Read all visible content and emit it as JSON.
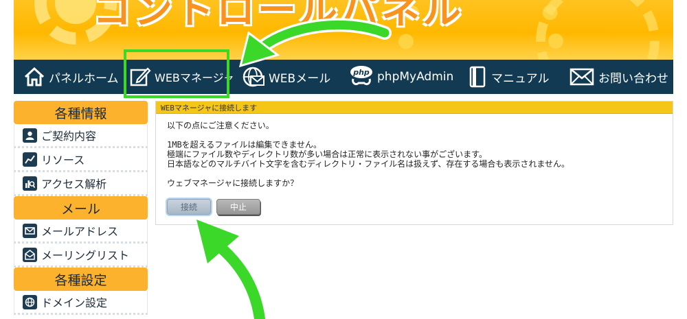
{
  "banner": {
    "title": "コントロールパネル"
  },
  "nav": {
    "items": [
      {
        "label": "パネルホーム",
        "icon": "home-icon"
      },
      {
        "label": "WEBマネージャ",
        "icon": "pencil-edit-icon"
      },
      {
        "label": "WEBメール",
        "icon": "globe-mail-icon"
      },
      {
        "label": "phpMyAdmin",
        "icon": "php-icon"
      },
      {
        "label": "マニュアル",
        "icon": "book-icon"
      },
      {
        "label": "お問い合わせ",
        "icon": "envelope-icon"
      }
    ]
  },
  "sidebar": {
    "sections": [
      {
        "heading": "各種情報",
        "items": [
          {
            "label": "ご契約内容",
            "icon": "user-icon"
          },
          {
            "label": "リソース",
            "icon": "chart-line-icon"
          },
          {
            "label": "アクセス解析",
            "icon": "analytics-icon"
          }
        ]
      },
      {
        "heading": "メール",
        "items": [
          {
            "label": "メールアドレス",
            "icon": "mail-icon"
          },
          {
            "label": "メーリングリスト",
            "icon": "mailing-list-icon"
          }
        ]
      },
      {
        "heading": "各種設定",
        "items": [
          {
            "label": "ドメイン設定",
            "icon": "globe-icon"
          }
        ]
      }
    ]
  },
  "panel": {
    "title": "WEBマネージャに接続します",
    "notice": "以下の点にご注意ください。",
    "lines": [
      "1MBを超えるファイルは編集できません。",
      "極端にファイル数やディレクトリ数が多い場合は正常に表示されない事がございます。",
      "日本語などのマルチバイト文字を含むディレクトリ・ファイル名は扱えず、存在する場合も表示されません。"
    ],
    "question": "ウェブマネージャに接続しますか？",
    "connect_label": "接続",
    "cancel_label": "中止"
  },
  "colors": {
    "navbar": "#123b53",
    "accent_orange": "#fdb22d",
    "panel_header": "#f5c518",
    "highlight_green": "#3bd82a"
  }
}
